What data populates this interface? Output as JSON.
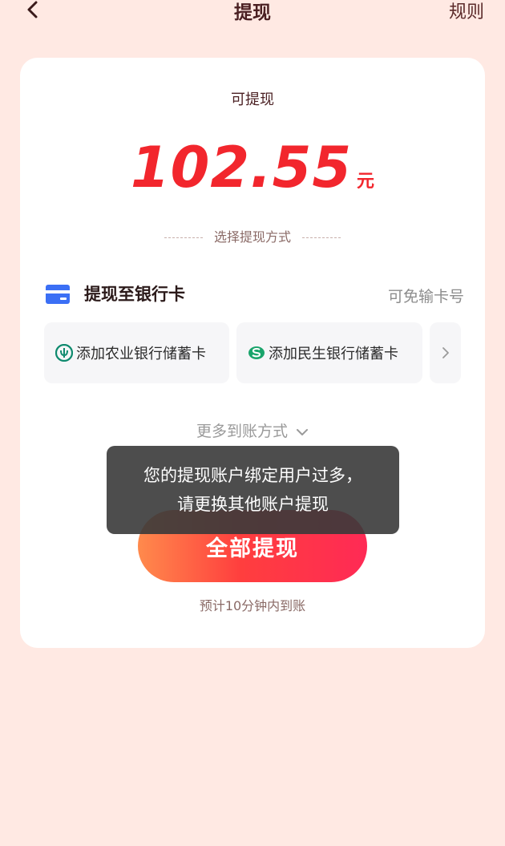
{
  "header": {
    "title": "提现",
    "rules_label": "规则"
  },
  "balance": {
    "label": "可提现",
    "amount": "102.55",
    "unit": "元"
  },
  "method_selector": {
    "label": "选择提现方式"
  },
  "bank_section": {
    "title": "提现至银行卡",
    "hint": "可免输卡号",
    "options": [
      {
        "label": "添加农业银行储蓄卡",
        "logo_color": "#0e8a6e",
        "icon": "abc-bank-logo-icon"
      },
      {
        "label": "添加民生银行储蓄卡",
        "logo_color": "#1aa46b",
        "icon": "cmbc-bank-logo-icon"
      }
    ]
  },
  "more_methods": {
    "label": "更多到账方式"
  },
  "withdraw_button": {
    "label": "全部提现"
  },
  "eta": {
    "text": "预计10分钟内到账"
  },
  "toast": {
    "message": "您的提现账户绑定用户过多，请更换其他账户提现"
  },
  "colors": {
    "background": "#ffe9e3",
    "amount": "#f2262d",
    "card_icon": "#3b6ff5"
  }
}
